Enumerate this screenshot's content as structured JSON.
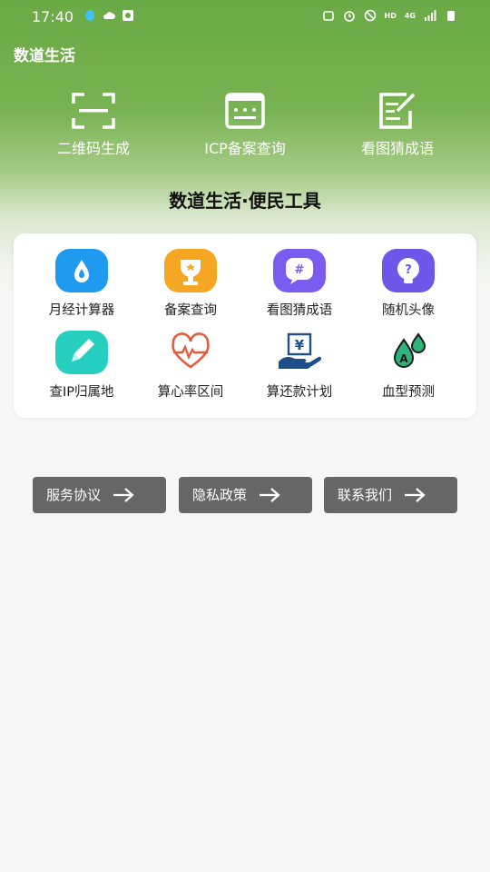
{
  "status_bar": {
    "time": "17:40",
    "hd": "HD",
    "net": "4G"
  },
  "app": {
    "title": "数道生活",
    "subtitle": "数道生活·便民工具"
  },
  "top_tools": [
    {
      "label": "二维码生成",
      "icon": "qr-scan-icon"
    },
    {
      "label": "ICP备案查询",
      "icon": "terminal-window-icon"
    },
    {
      "label": "看图猜成语",
      "icon": "edit-note-icon"
    }
  ],
  "tools": [
    {
      "label": "月经计算器",
      "icon": "droplet-icon",
      "color": "#1e9bf0"
    },
    {
      "label": "备案查询",
      "icon": "trophy-icon",
      "color": "#f5a623"
    },
    {
      "label": "看图猜成语",
      "icon": "chat-hash-icon",
      "color": "#7b5cf0"
    },
    {
      "label": "随机头像",
      "icon": "question-bulb-icon",
      "color": "#6d56e8"
    },
    {
      "label": "查IP归属地",
      "icon": "pencil-icon",
      "color": "#27cfc0"
    },
    {
      "label": "算心率区间",
      "icon": "heart-rate-icon",
      "color": "#e45c3e"
    },
    {
      "label": "算还款计划",
      "icon": "yen-hand-icon",
      "color": "#1d4f8a"
    },
    {
      "label": "血型预测",
      "icon": "blood-drops-icon",
      "color": "#2fb37a"
    }
  ],
  "footer_buttons": [
    {
      "label": "服务协议"
    },
    {
      "label": "隐私政策"
    },
    {
      "label": "联系我们"
    }
  ]
}
